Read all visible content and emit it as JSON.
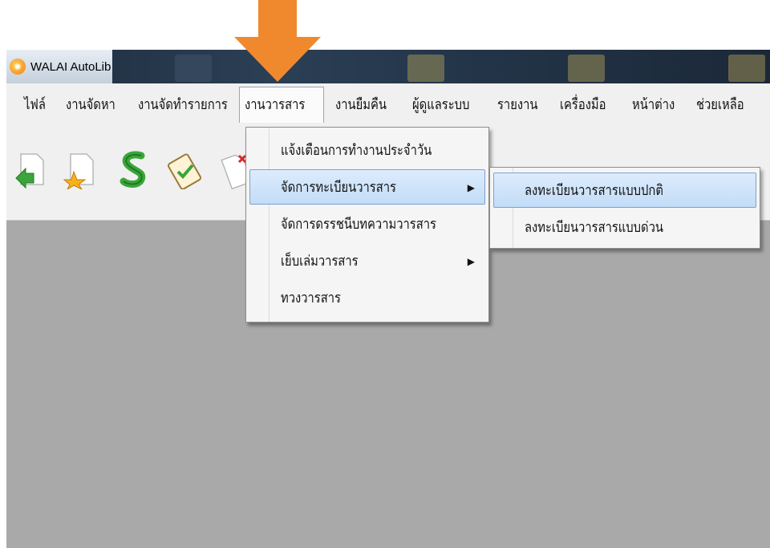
{
  "window": {
    "title": "WALAI AutoLib",
    "logo_icon": "walai-logo-icon"
  },
  "menubar": {
    "items": [
      {
        "label": "ไฟล์"
      },
      {
        "label": "งานจัดหา"
      },
      {
        "label": "งานจัดทำรายการ"
      },
      {
        "label": "งานวารสาร",
        "active": true
      },
      {
        "label": "งานยืมคืน"
      },
      {
        "label": "ผู้ดูแลระบบ"
      },
      {
        "label": "รายงาน"
      },
      {
        "label": "เครื่องมือ"
      },
      {
        "label": "หน้าต่าง"
      },
      {
        "label": "ช่วยเหลือ"
      }
    ]
  },
  "toolbar": {
    "icons": [
      "green-arrow-icon",
      "star-bookmark-icon",
      "green-s-icon",
      "clipboard-check-icon",
      "document-x-icon"
    ]
  },
  "dropdown": {
    "items": [
      {
        "label": "แจ้งเตือนการทำงานประจำวัน"
      },
      {
        "label": "จัดการทะเบียนวารสาร",
        "submenu": true,
        "highlighted": true
      },
      {
        "label": "จัดการดรรชนีบทความวารสาร"
      },
      {
        "label": "เย็บเล่มวารสาร",
        "submenu": true
      },
      {
        "label": "ทวงวารสาร"
      }
    ],
    "submenu_arrow": "▶"
  },
  "submenu": {
    "items": [
      {
        "label": "ลงทะเบียนวารสารแบบปกติ",
        "highlighted": true
      },
      {
        "label": "ลงทะเบียนวารสารแบบด่วน"
      }
    ]
  },
  "colors": {
    "arrow": "#f0892e",
    "highlight": "#c2dcf7",
    "workspace": "#a9a9a9"
  }
}
